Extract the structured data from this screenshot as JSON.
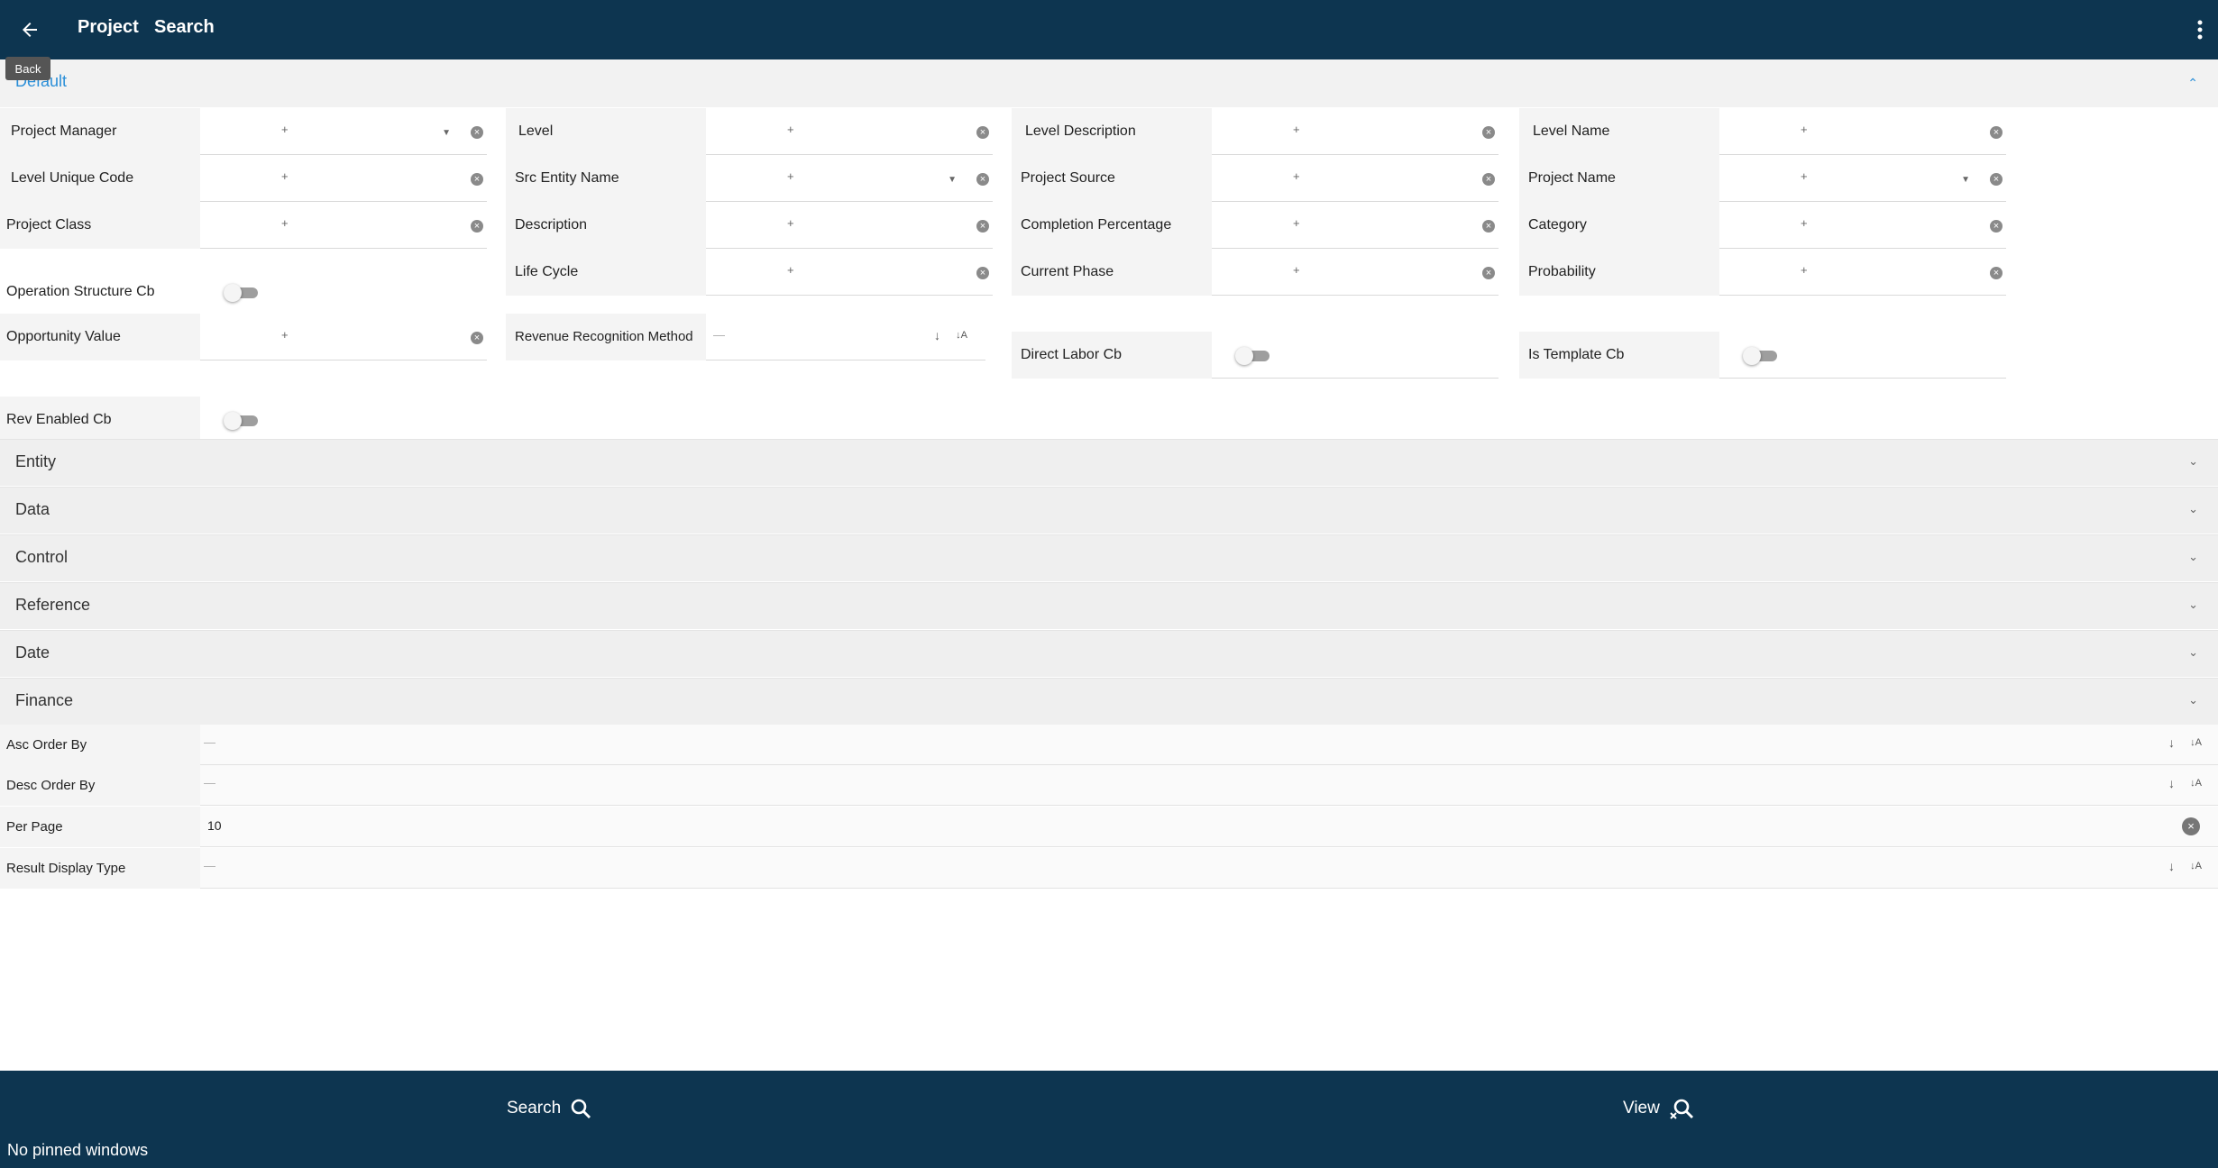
{
  "header": {
    "title": "Project",
    "subtitle": "Search",
    "back_tooltip": "Back"
  },
  "default_section": {
    "label": "Default",
    "fields": [
      {
        "label": "Project Manager",
        "type": "select"
      },
      {
        "label": "Level",
        "type": "text"
      },
      {
        "label": "Level Description",
        "type": "text"
      },
      {
        "label": "Level Name",
        "type": "text"
      },
      {
        "label": "Level Unique Code",
        "type": "text"
      },
      {
        "label": "Src Entity Name",
        "type": "select"
      },
      {
        "label": "Project Source",
        "type": "text"
      },
      {
        "label": "Project Name",
        "type": "select"
      },
      {
        "label": "Project Class",
        "type": "text"
      },
      {
        "label": "Description",
        "type": "text"
      },
      {
        "label": "Completion Percentage",
        "type": "text"
      },
      {
        "label": "Category",
        "type": "text"
      },
      {
        "label": "Life Cycle",
        "type": "text"
      },
      {
        "label": "Current Phase",
        "type": "text"
      },
      {
        "label": "Probability",
        "type": "text"
      },
      {
        "label": "Operation Structure Cb",
        "type": "toggle"
      },
      {
        "label": "Opportunity Value",
        "type": "text"
      },
      {
        "label": "Revenue Recognition Method",
        "type": "sortable"
      },
      {
        "label": "Direct Labor Cb",
        "type": "toggle"
      },
      {
        "label": "Is Template Cb",
        "type": "toggle"
      },
      {
        "label": "Rev Enabled Cb",
        "type": "toggle"
      }
    ],
    "placeholder_glyph": "+",
    "dash": "—"
  },
  "sections": [
    {
      "label": "Entity"
    },
    {
      "label": "Data"
    },
    {
      "label": "Control"
    },
    {
      "label": "Reference"
    },
    {
      "label": "Date"
    },
    {
      "label": "Finance"
    }
  ],
  "bottom_fields": [
    {
      "label": "Asc Order By",
      "value": "—"
    },
    {
      "label": "Desc Order By",
      "value": "—"
    },
    {
      "label": "Per Page",
      "value": "10"
    },
    {
      "label": "Result Display Type",
      "value": "—"
    }
  ],
  "footer": {
    "search_label": "Search",
    "view_label": "View",
    "pinned_text": "No pinned windows"
  },
  "colors": {
    "primary": "#0d3550",
    "accent": "#2b8fd8"
  }
}
